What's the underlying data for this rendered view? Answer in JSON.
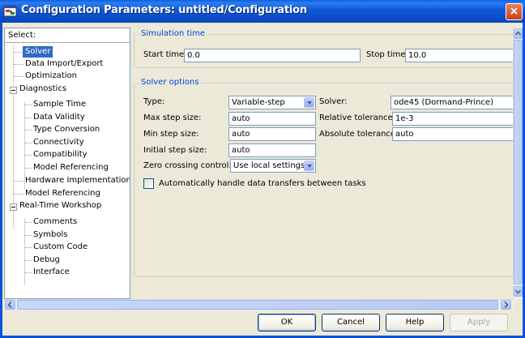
{
  "window": {
    "title": "Configuration Parameters: untitled/Configuration",
    "close_glyph": "×"
  },
  "tree": {
    "header": "Select:",
    "items": [
      {
        "label": "Solver",
        "depth": 1,
        "selected": true
      },
      {
        "label": "Data Import/Export",
        "depth": 1
      },
      {
        "label": "Optimization",
        "depth": 1
      },
      {
        "label": "Diagnostics",
        "depth": 0,
        "expanded": true
      },
      {
        "label": "Sample Time",
        "depth": 2
      },
      {
        "label": "Data Validity",
        "depth": 2
      },
      {
        "label": "Type Conversion",
        "depth": 2
      },
      {
        "label": "Connectivity",
        "depth": 2
      },
      {
        "label": "Compatibility",
        "depth": 2
      },
      {
        "label": "Model Referencing",
        "depth": 2
      },
      {
        "label": "Hardware Implementation",
        "depth": 1
      },
      {
        "label": "Model Referencing",
        "depth": 1
      },
      {
        "label": "Real-Time Workshop",
        "depth": 0,
        "expanded": true
      },
      {
        "label": "Comments",
        "depth": 2
      },
      {
        "label": "Symbols",
        "depth": 2
      },
      {
        "label": "Custom Code",
        "depth": 2
      },
      {
        "label": "Debug",
        "depth": 2
      },
      {
        "label": "Interface",
        "depth": 2
      }
    ]
  },
  "simulation_time": {
    "legend": "Simulation time",
    "start_label": "Start time:",
    "start_value": "0.0",
    "stop_label": "Stop time:",
    "stop_value": "10.0"
  },
  "solver_options": {
    "legend": "Solver options",
    "type_label": "Type:",
    "type_value": "Variable-step",
    "solver_label": "Solver:",
    "solver_value": "ode45 (Dormand-Prince)",
    "max_step_label": "Max step size:",
    "max_step_value": "auto",
    "rel_tol_label": "Relative tolerance:",
    "rel_tol_value": "1e-3",
    "min_step_label": "Min step size:",
    "min_step_value": "auto",
    "abs_tol_label": "Absolute tolerance:",
    "abs_tol_value": "auto",
    "init_step_label": "Initial step size:",
    "init_step_value": "auto",
    "zero_cross_label": "Zero crossing control:",
    "zero_cross_value": "Use local settings",
    "auto_handle_label": "Automatically handle data transfers between tasks",
    "auto_handle_checked": false
  },
  "buttons": {
    "ok": "OK",
    "cancel": "Cancel",
    "help": "Help",
    "apply": "Apply"
  },
  "colors": {
    "titlebar": "#0B4CC8",
    "selection": "#316AC5",
    "group_legend": "#0046D5",
    "window_bg": "#ECE9D8"
  },
  "icons": {
    "window": "simulink-config-icon",
    "close": "close-icon",
    "scroll_up": "scroll-up-arrow-icon",
    "scroll_down": "scroll-down-arrow-icon",
    "scroll_left": "scroll-left-arrow-icon",
    "scroll_right": "scroll-right-arrow-icon"
  }
}
